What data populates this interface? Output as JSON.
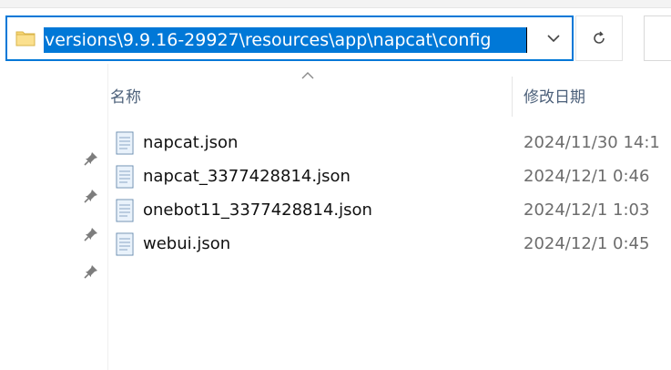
{
  "address_bar": {
    "path": "versions\\9.9.16-29927\\resources\\app\\napcat\\config"
  },
  "icons": {
    "folder": "folder-icon",
    "dropdown": "chevron-down-icon",
    "refresh": "refresh-icon",
    "pin": "pin-icon",
    "sort": "sort-up-icon",
    "file": "json-file-icon"
  },
  "columns": {
    "name": "名称",
    "date_modified": "修改日期"
  },
  "files": [
    {
      "name": "napcat.json",
      "modified": "2024/11/30 14:1"
    },
    {
      "name": "napcat_3377428814.json",
      "modified": "2024/12/1 0:46"
    },
    {
      "name": "onebot11_3377428814.json",
      "modified": "2024/12/1 1:03"
    },
    {
      "name": "webui.json",
      "modified": "2024/12/1 0:45"
    }
  ],
  "colors": {
    "accent": "#0078d7",
    "header_text": "#4c607a"
  }
}
